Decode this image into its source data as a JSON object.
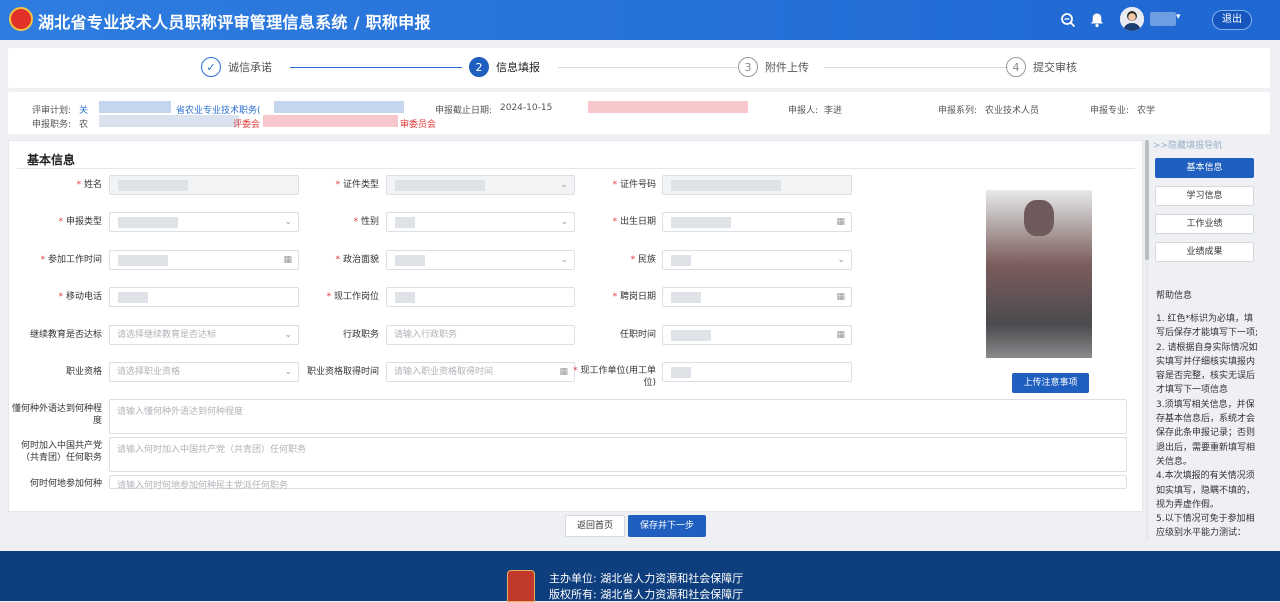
{
  "header": {
    "title": "湖北省专业技术人员职称评审管理信息系统 / 职称申报",
    "logout": "退出",
    "icons": [
      "emblem-icon",
      "search-icon",
      "bell-icon",
      "user-avatar",
      "chevron-down-icon"
    ]
  },
  "steps": [
    {
      "num": "✓",
      "label": "诚信承诺",
      "state": "done"
    },
    {
      "num": "2",
      "label": "信息填报",
      "state": "active"
    },
    {
      "num": "3",
      "label": "附件上传",
      "state": "pending"
    },
    {
      "num": "4",
      "label": "提交审核",
      "state": "pending"
    }
  ],
  "info": {
    "plan_label": "评审计划:",
    "plan_prefix": "关",
    "plan_text": "省农业专业技术职务(",
    "deadline_label": "申报截止日期:",
    "deadline_value": "2024-10-15",
    "applicant_label": "申报人:",
    "applicant_value": "李进",
    "series_label": "申报系列:",
    "series_value": "农业技术人员",
    "major_label": "申报专业:",
    "major_value": "农学",
    "position_label": "申报职务:",
    "position_prefix": "农",
    "committee1": "评委会",
    "committee2": "审委员会"
  },
  "form": {
    "section_title": "基本信息",
    "fields": {
      "name": "姓名",
      "id_type": "证件类型",
      "id_number": "证件号码",
      "apply_type": "申报类型",
      "gender": "性别",
      "birth_date": "出生日期",
      "work_start": "参加工作时间",
      "political": "政治面貌",
      "ethnicity": "民族",
      "mobile": "移动电话",
      "current_post": "现工作岗位",
      "hire_date": "聘岗日期",
      "cont_edu": "继续教育是否达标",
      "cont_edu_ph": "请选择继续教育是否达标",
      "admin_post": "行政职务",
      "admin_post_ph": "请输入行政职务",
      "appoint_time": "任职时间",
      "qualification": "职业资格",
      "qualification_ph": "请选择职业资格",
      "qual_time": "职业资格取得时间",
      "qual_time_ph": "请输入职业资格取得时间",
      "employer": "现工作单位(用工单位)",
      "language": "懂何种外语达到何种程度",
      "language_ph": "请输入懂何种外语达到何种程度",
      "party": "何时加入中国共产党（共青团）任何职务",
      "party_ph": "请输入何时加入中国共产党（共青团）任何职务",
      "other": "何时何地参加何种",
      "other_ph": "请输入何时何地参加何种民主党派任何职务"
    },
    "upload_notice": "上传注意事项"
  },
  "sidebar": {
    "toggle": ">>隐藏填报导航",
    "items": [
      "基本信息",
      "学习信息",
      "工作业绩",
      "业绩成果"
    ],
    "help_title": "帮助信息",
    "help_text": "1. 红色*标识为必填，填写后保存才能填写下一项;\n2. 请根据自身实际情况如实填写并仔细核实填报内容是否完整，核实无误后才填写下一项信息\n3.须填写相关信息，并保存基本信息后，系统才会保存此条申报记录；否则退出后，需要重新填写相关信息。\n4.本次填报的有关情况须如实填写，隐瞒不填的，视为弄虚作假。\n5.以下情况可免于参加相应级别水平能力测试："
  },
  "buttons": {
    "back": "返回首页",
    "save_next": "保存并下一步"
  },
  "footer": {
    "host": "主办单位:  湖北省人力资源和社会保障厅",
    "copyright": "版权所有:  湖北省人力资源和社会保障厅"
  },
  "colors": {
    "primary": "#1f5fc0",
    "header": "#2f7de0",
    "footer": "#0f3e7e",
    "required": "#e23b3b"
  }
}
